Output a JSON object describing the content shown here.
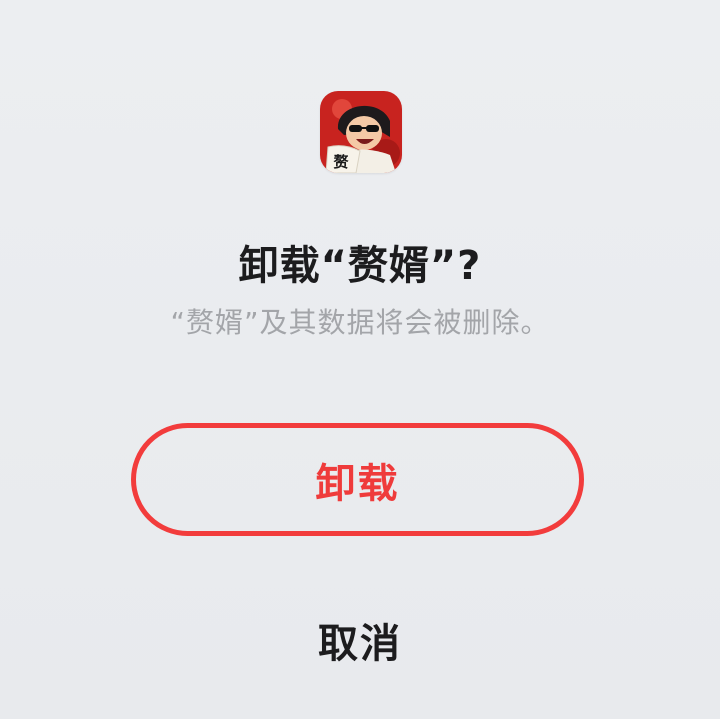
{
  "dialog": {
    "app_icon": "zhuixu-game-icon",
    "app_icon_glyph": "赘",
    "title": "卸载“赘婿”?",
    "message": "“赘婿”及其数据将会被删除。",
    "uninstall_label": "卸载",
    "cancel_label": "取消"
  },
  "colors": {
    "background": "#e9ebee",
    "accent": "#ef3b3b",
    "title": "#1c1c1e",
    "message": "#a3a5a9"
  }
}
